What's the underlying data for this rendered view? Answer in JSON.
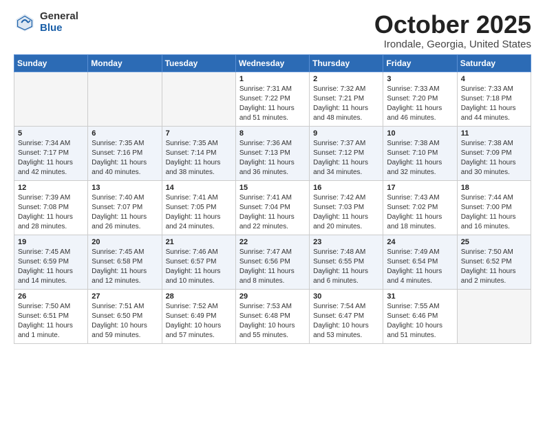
{
  "logo": {
    "general": "General",
    "blue": "Blue"
  },
  "title": "October 2025",
  "location": "Irondale, Georgia, United States",
  "days_of_week": [
    "Sunday",
    "Monday",
    "Tuesday",
    "Wednesday",
    "Thursday",
    "Friday",
    "Saturday"
  ],
  "weeks": [
    [
      {
        "day": "",
        "info": ""
      },
      {
        "day": "",
        "info": ""
      },
      {
        "day": "",
        "info": ""
      },
      {
        "day": "1",
        "info": "Sunrise: 7:31 AM\nSunset: 7:22 PM\nDaylight: 11 hours\nand 51 minutes."
      },
      {
        "day": "2",
        "info": "Sunrise: 7:32 AM\nSunset: 7:21 PM\nDaylight: 11 hours\nand 48 minutes."
      },
      {
        "day": "3",
        "info": "Sunrise: 7:33 AM\nSunset: 7:20 PM\nDaylight: 11 hours\nand 46 minutes."
      },
      {
        "day": "4",
        "info": "Sunrise: 7:33 AM\nSunset: 7:18 PM\nDaylight: 11 hours\nand 44 minutes."
      }
    ],
    [
      {
        "day": "5",
        "info": "Sunrise: 7:34 AM\nSunset: 7:17 PM\nDaylight: 11 hours\nand 42 minutes."
      },
      {
        "day": "6",
        "info": "Sunrise: 7:35 AM\nSunset: 7:16 PM\nDaylight: 11 hours\nand 40 minutes."
      },
      {
        "day": "7",
        "info": "Sunrise: 7:35 AM\nSunset: 7:14 PM\nDaylight: 11 hours\nand 38 minutes."
      },
      {
        "day": "8",
        "info": "Sunrise: 7:36 AM\nSunset: 7:13 PM\nDaylight: 11 hours\nand 36 minutes."
      },
      {
        "day": "9",
        "info": "Sunrise: 7:37 AM\nSunset: 7:12 PM\nDaylight: 11 hours\nand 34 minutes."
      },
      {
        "day": "10",
        "info": "Sunrise: 7:38 AM\nSunset: 7:10 PM\nDaylight: 11 hours\nand 32 minutes."
      },
      {
        "day": "11",
        "info": "Sunrise: 7:38 AM\nSunset: 7:09 PM\nDaylight: 11 hours\nand 30 minutes."
      }
    ],
    [
      {
        "day": "12",
        "info": "Sunrise: 7:39 AM\nSunset: 7:08 PM\nDaylight: 11 hours\nand 28 minutes."
      },
      {
        "day": "13",
        "info": "Sunrise: 7:40 AM\nSunset: 7:07 PM\nDaylight: 11 hours\nand 26 minutes."
      },
      {
        "day": "14",
        "info": "Sunrise: 7:41 AM\nSunset: 7:05 PM\nDaylight: 11 hours\nand 24 minutes."
      },
      {
        "day": "15",
        "info": "Sunrise: 7:41 AM\nSunset: 7:04 PM\nDaylight: 11 hours\nand 22 minutes."
      },
      {
        "day": "16",
        "info": "Sunrise: 7:42 AM\nSunset: 7:03 PM\nDaylight: 11 hours\nand 20 minutes."
      },
      {
        "day": "17",
        "info": "Sunrise: 7:43 AM\nSunset: 7:02 PM\nDaylight: 11 hours\nand 18 minutes."
      },
      {
        "day": "18",
        "info": "Sunrise: 7:44 AM\nSunset: 7:00 PM\nDaylight: 11 hours\nand 16 minutes."
      }
    ],
    [
      {
        "day": "19",
        "info": "Sunrise: 7:45 AM\nSunset: 6:59 PM\nDaylight: 11 hours\nand 14 minutes."
      },
      {
        "day": "20",
        "info": "Sunrise: 7:45 AM\nSunset: 6:58 PM\nDaylight: 11 hours\nand 12 minutes."
      },
      {
        "day": "21",
        "info": "Sunrise: 7:46 AM\nSunset: 6:57 PM\nDaylight: 11 hours\nand 10 minutes."
      },
      {
        "day": "22",
        "info": "Sunrise: 7:47 AM\nSunset: 6:56 PM\nDaylight: 11 hours\nand 8 minutes."
      },
      {
        "day": "23",
        "info": "Sunrise: 7:48 AM\nSunset: 6:55 PM\nDaylight: 11 hours\nand 6 minutes."
      },
      {
        "day": "24",
        "info": "Sunrise: 7:49 AM\nSunset: 6:54 PM\nDaylight: 11 hours\nand 4 minutes."
      },
      {
        "day": "25",
        "info": "Sunrise: 7:50 AM\nSunset: 6:52 PM\nDaylight: 11 hours\nand 2 minutes."
      }
    ],
    [
      {
        "day": "26",
        "info": "Sunrise: 7:50 AM\nSunset: 6:51 PM\nDaylight: 11 hours\nand 1 minute."
      },
      {
        "day": "27",
        "info": "Sunrise: 7:51 AM\nSunset: 6:50 PM\nDaylight: 10 hours\nand 59 minutes."
      },
      {
        "day": "28",
        "info": "Sunrise: 7:52 AM\nSunset: 6:49 PM\nDaylight: 10 hours\nand 57 minutes."
      },
      {
        "day": "29",
        "info": "Sunrise: 7:53 AM\nSunset: 6:48 PM\nDaylight: 10 hours\nand 55 minutes."
      },
      {
        "day": "30",
        "info": "Sunrise: 7:54 AM\nSunset: 6:47 PM\nDaylight: 10 hours\nand 53 minutes."
      },
      {
        "day": "31",
        "info": "Sunrise: 7:55 AM\nSunset: 6:46 PM\nDaylight: 10 hours\nand 51 minutes."
      },
      {
        "day": "",
        "info": ""
      }
    ]
  ]
}
